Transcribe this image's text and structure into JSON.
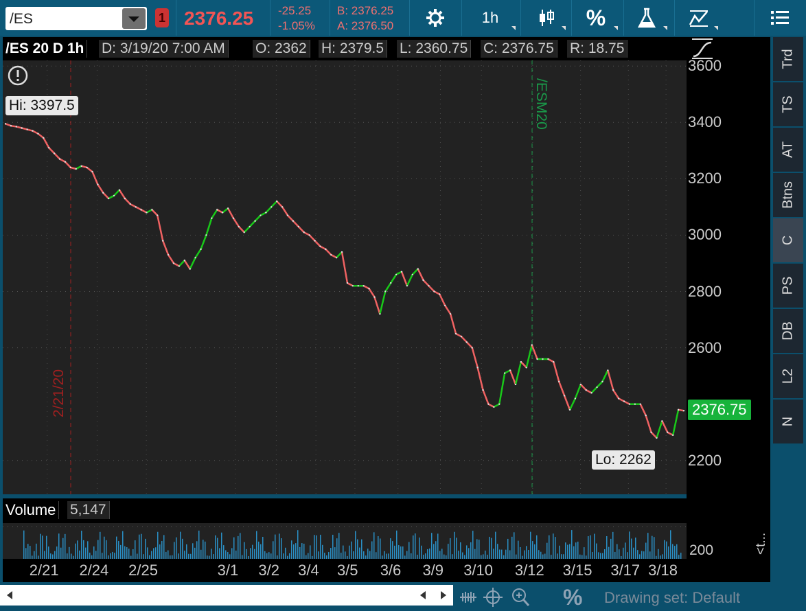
{
  "toolbar": {
    "symbol": "/ES",
    "alert_badge": "1",
    "last_price": "2376.25",
    "change_abs": "-25.25",
    "change_pct": "-1.05%",
    "bid": "B: 2376.25",
    "ask": "A: 2376.50",
    "timeframe": "1h",
    "percent_label": "%",
    "icons": [
      "gear-icon",
      "candlestick-icon",
      "percent-icon",
      "flask-icon",
      "drawing-icon",
      "menu-icon"
    ]
  },
  "infobar": {
    "title": "/ES 20 D 1h",
    "date": "D: 3/19/20 7:00 AM",
    "open": "O: 2362",
    "high": "H: 2379.5",
    "low": "L: 2360.75",
    "close": "C: 2376.75",
    "range": "R: 18.75"
  },
  "chart_data": {
    "type": "line",
    "y_ticks": [
      "3600",
      "3400",
      "3200",
      "3000",
      "2800",
      "2600",
      "2200"
    ],
    "ylim": [
      2080,
      3620
    ],
    "x_tick_labels": [
      "2/21",
      "2/24",
      "2/25",
      "3/1",
      "3/2",
      "3/4",
      "3/5",
      "3/6",
      "3/9",
      "3/10",
      "3/12",
      "3/15",
      "3/17",
      "3/18"
    ],
    "series": [
      {
        "values": [
          3395,
          3388,
          3385,
          3380,
          3375,
          3370,
          3360,
          3345,
          3310,
          3290,
          3270,
          3260,
          3240,
          3235,
          3245,
          3240,
          3225,
          3180,
          3150,
          3130,
          3140,
          3160,
          3130,
          3110,
          3100,
          3090,
          3080,
          3090,
          3070,
          2980,
          2930,
          2900,
          2890,
          2910,
          2880,
          2920,
          2950,
          3000,
          3060,
          3090,
          3080,
          3095,
          3060,
          3030,
          3010,
          3030,
          3050,
          3070,
          3080,
          3100,
          3120,
          3100,
          3070,
          3050,
          3030,
          3010,
          3000,
          2980,
          2960,
          2950,
          2930,
          2920,
          2940,
          2830,
          2820,
          2820,
          2820,
          2810,
          2780,
          2720,
          2800,
          2830,
          2860,
          2870,
          2820,
          2860,
          2880,
          2840,
          2820,
          2800,
          2790,
          2750,
          2720,
          2650,
          2640,
          2620,
          2600,
          2530,
          2450,
          2400,
          2390,
          2400,
          2510,
          2520,
          2470,
          2550,
          2530,
          2610,
          2560,
          2560,
          2560,
          2550,
          2480,
          2430,
          2380,
          2420,
          2470,
          2450,
          2440,
          2460,
          2480,
          2520,
          2450,
          2420,
          2410,
          2400,
          2400,
          2400,
          2360,
          2300,
          2280,
          2340,
          2300,
          2290,
          2380,
          2376.75
        ]
      }
    ],
    "annotations": {
      "high": "Hi: 3397.5",
      "low": "Lo: 2262",
      "date_marker": "2/21/20",
      "contract_marker": "/ESM20",
      "price_tag": "2376.75"
    },
    "volume": {
      "label": "Volume",
      "value": "5,147",
      "axis_tick": "200"
    },
    "colors": {
      "up": "#19c919",
      "down": "#f06262",
      "volume": "#2a8fc4",
      "price_tag_bg": "#17b33b"
    }
  },
  "right_tabs": [
    "Trd",
    "TS",
    "AT",
    "Btns",
    "C",
    "PS",
    "DB",
    "L2",
    "N"
  ],
  "side_label": "<t...",
  "bottom": {
    "drawing_set": "Drawing set: Default",
    "percent": "%"
  }
}
